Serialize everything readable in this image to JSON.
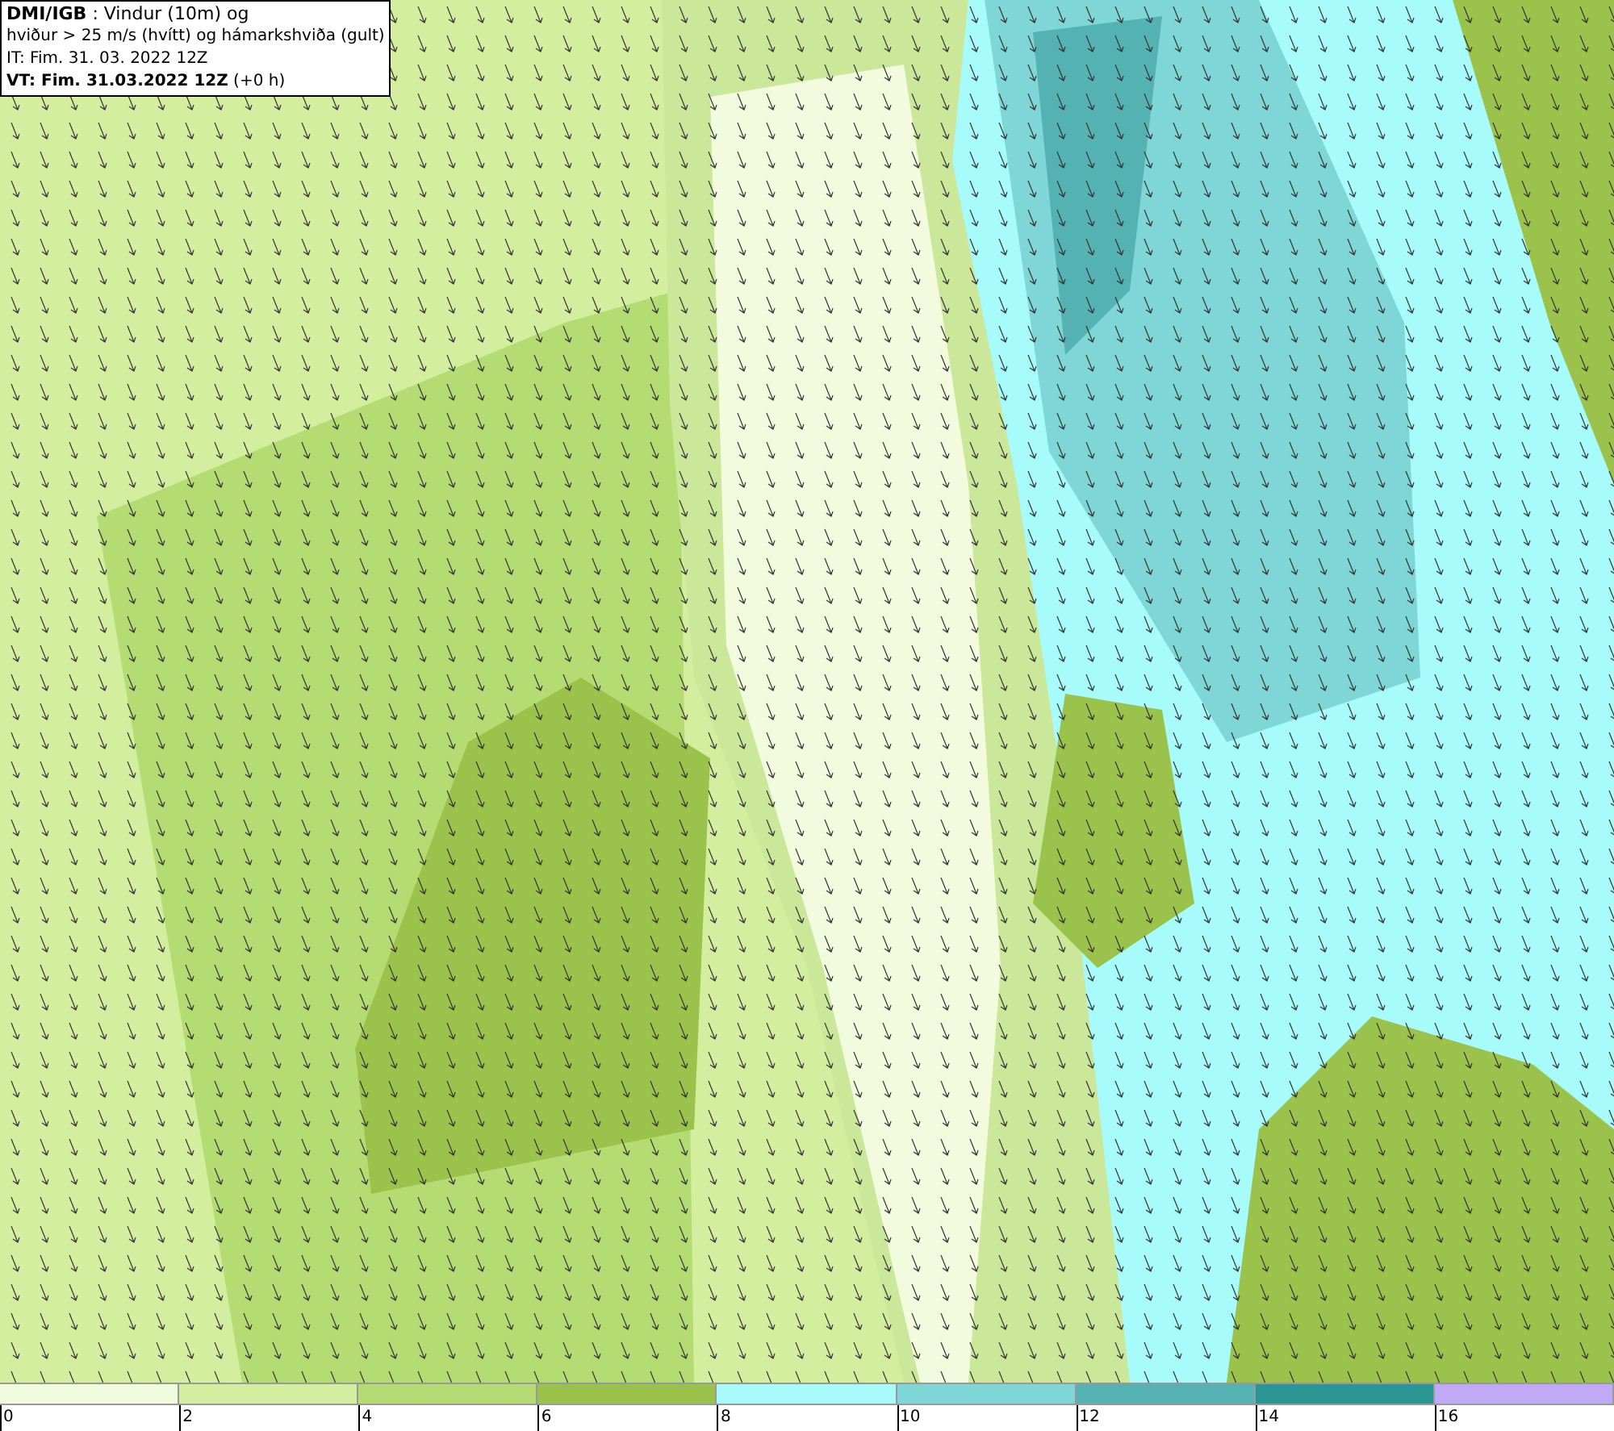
{
  "header": {
    "lines": [
      "**DMI/IGB** : Vindur (10m) og",
      "hviður > 25 m/s (hvítt) og hámarkshviða (gult)",
      "IT: Fim. 31. 03. 2022 12Z",
      "**VT: Fim. 31.03.2022 12Z** (+0 h)"
    ]
  },
  "legend": {
    "bins": [
      {
        "color": "#f3fbde",
        "label": "0"
      },
      {
        "color": "#d4eea0",
        "label": "2"
      },
      {
        "color": "#b5dc72",
        "label": "4"
      },
      {
        "color": "#9bc24a",
        "label": "6"
      },
      {
        "color": "#a8fbfb",
        "label": "8"
      },
      {
        "color": "#7fd6d6",
        "label": "10"
      },
      {
        "color": "#55b2b2",
        "label": "12"
      },
      {
        "color": "#2a9595",
        "label": "14"
      },
      {
        "color": "#c0aaf5",
        "label": "16"
      }
    ]
  }
}
